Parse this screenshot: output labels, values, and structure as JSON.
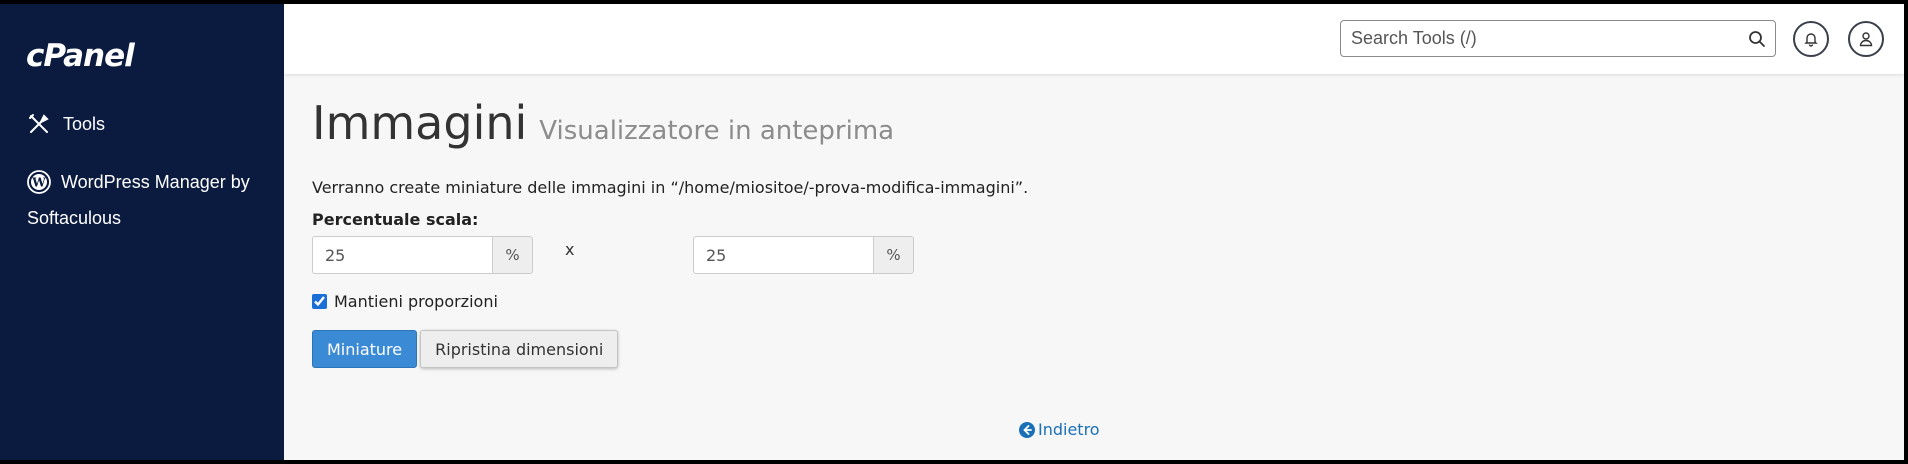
{
  "brand": {
    "logo_text": "cPanel"
  },
  "sidebar": {
    "items": [
      {
        "label": "Tools",
        "icon": "tools-icon"
      },
      {
        "label_line1": "WordPress Manager by",
        "label_line2": "Softaculous",
        "icon": "wordpress-icon"
      }
    ],
    "background": "#0b1b3f"
  },
  "topbar": {
    "search_placeholder": "Search Tools (/)",
    "notifications_icon": "bell-icon",
    "user_icon": "user-icon"
  },
  "page": {
    "title": "Immagini",
    "subtitle": "Visualizzatore in anteprima",
    "info_text": "Verranno create miniature delle immagini in “/home/miositoe/-prova-modifica-immagini”.",
    "scale_label": "Percentuale scala:",
    "width_value": "25",
    "height_value": "25",
    "percent_symbol": "%",
    "times_symbol": "x",
    "keep_proportions_label": "Mantieni proporzioni",
    "keep_proportions_checked": true,
    "thumbnail_button": "Miniature",
    "reset_button": "Ripristina dimensioni",
    "back_link": "Indietro"
  },
  "colors": {
    "primary_button": "#3a8ad6",
    "link": "#1a6fb6",
    "sidebar": "#0b1b3f"
  }
}
